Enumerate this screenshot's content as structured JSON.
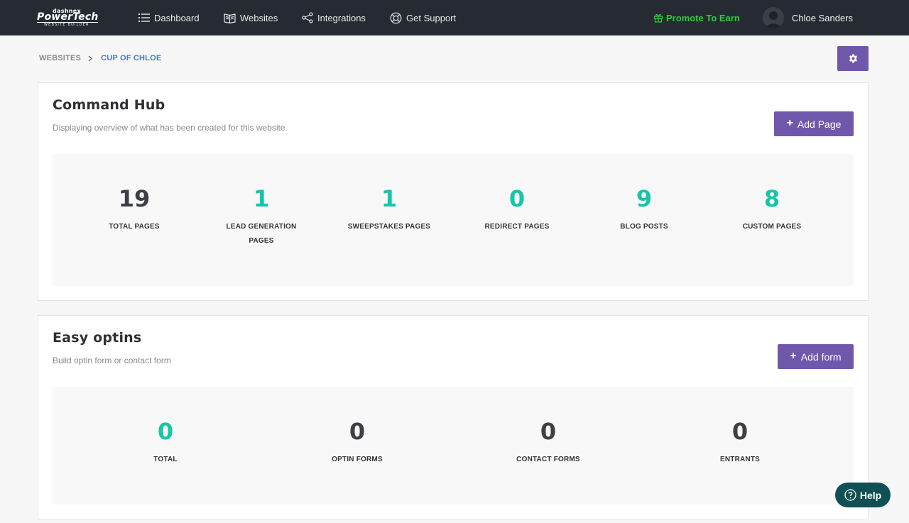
{
  "nav": {
    "logo": {
      "brand_top": "dashnex",
      "brand_main": "PowerTech",
      "brand_tag": "WEBSITE BUILDER"
    },
    "items": [
      {
        "label": "Dashboard",
        "icon": "list-icon"
      },
      {
        "label": "Websites",
        "icon": "book-icon"
      },
      {
        "label": "Integrations",
        "icon": "share-icon"
      },
      {
        "label": "Get Support",
        "icon": "lifebuoy-icon"
      }
    ],
    "promote_label": "Promote To Earn",
    "user_name": "Chloe Sanders"
  },
  "breadcrumb": {
    "root": "WEBSITES",
    "current": "CUP OF CHLOE"
  },
  "command_hub": {
    "title": "Command Hub",
    "subtitle": "Displaying overview of what has been created for this website",
    "add_label": "Add Page",
    "stats": [
      {
        "value": "19",
        "label": "TOTAL PAGES"
      },
      {
        "value": "1",
        "label": "LEAD GENERATION PAGES"
      },
      {
        "value": "1",
        "label": "SWEEPSTAKES PAGES"
      },
      {
        "value": "0",
        "label": "REDIRECT PAGES"
      },
      {
        "value": "9",
        "label": "BLOG POSTS"
      },
      {
        "value": "8",
        "label": "CUSTOM PAGES"
      }
    ]
  },
  "easy_optins": {
    "title": "Easy optins",
    "subtitle": "Build optin form or contact form",
    "add_label": "Add form",
    "stats": [
      {
        "value": "0",
        "label": "TOTAL"
      },
      {
        "value": "0",
        "label": "OPTIN FORMS"
      },
      {
        "value": "0",
        "label": "CONTACT FORMS"
      },
      {
        "value": "0",
        "label": "ENTRANTS"
      }
    ]
  },
  "help_label": "Help",
  "colors": {
    "accent": "#6f58ab",
    "teal": "#14c7a8",
    "promote": "#2ecc40",
    "nav_bg": "#262b33",
    "help_bg": "#0f5054"
  }
}
